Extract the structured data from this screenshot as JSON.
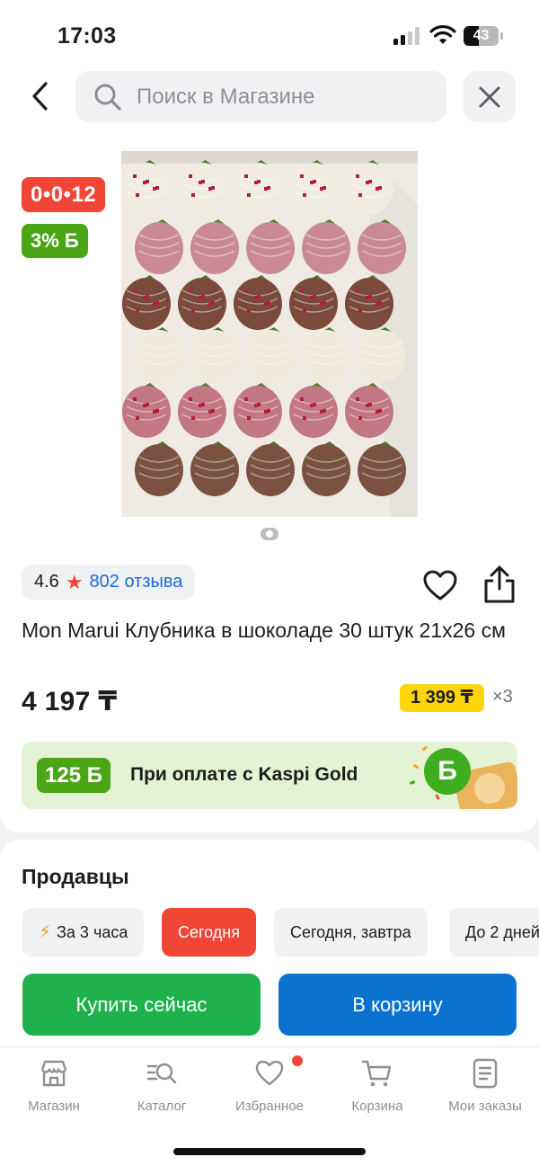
{
  "status_bar": {
    "time": "17:03",
    "battery": "43",
    "battery_level": 0.43
  },
  "search": {
    "placeholder": "Поиск в Магазине",
    "value": ""
  },
  "product": {
    "timer_badge": "0•0•12",
    "bonus_badge": "3% Б",
    "rating": "4.6",
    "reviews": "802 отзыва",
    "title": "Mon Marui Клубника в шоколаде 30 штук 21x26 см",
    "price": "4 197 ₸",
    "installment_price": "1 399 ₸",
    "installment_multiplier": "×3"
  },
  "promo": {
    "amount": "125 Б",
    "text": "При оплате с Kaspi Gold",
    "coin_glyph": "Б"
  },
  "sellers": {
    "title": "Продавцы",
    "filters": [
      "За 3 часа",
      "Сегодня",
      "Сегодня, завтра",
      "До 2 дней"
    ],
    "selected_filter": "Сегодня"
  },
  "actions": {
    "buy_now": "Купить сейчас",
    "add_to_cart": "В корзину"
  },
  "tabbar": {
    "items": [
      {
        "label": "Магазин",
        "icon": "store-icon"
      },
      {
        "label": "Каталог",
        "icon": "catalog-search-icon"
      },
      {
        "label": "Избранное",
        "icon": "heart-icon"
      },
      {
        "label": "Корзина",
        "icon": "cart-icon"
      },
      {
        "label": "Мои заказы",
        "icon": "orders-icon"
      }
    ]
  },
  "colors": {
    "accent_red": "#f14635",
    "bonus_green": "#4aa517",
    "buy_green": "#1fb14e",
    "cart_blue": "#0a73d0",
    "installment_yellow": "#fdd50a",
    "link_blue": "#1b6ad8"
  }
}
